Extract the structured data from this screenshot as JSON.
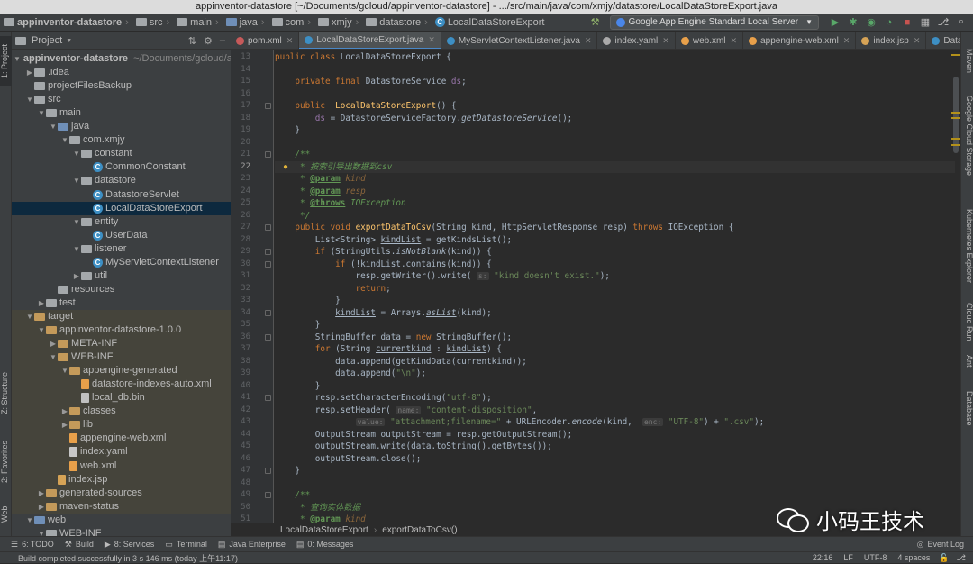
{
  "window": {
    "title": "appinventor-datastore [~/Documents/gcloud/appinventor-datastore] - .../src/main/java/com/xmjy/datastore/LocalDataStoreExport.java"
  },
  "nav": {
    "crumbs": [
      "appinventor-datastore",
      "src",
      "main",
      "java",
      "com",
      "xmjy",
      "datastore",
      "LocalDataStoreExport"
    ],
    "run_config": "Google App Engine Standard Local Server"
  },
  "left_strip": {
    "project": "1: Project",
    "structure": "Z: Structure",
    "favorites": "2: Favorites",
    "web": "Web"
  },
  "right_strip": {
    "maven": "Maven",
    "gcs": "Google Cloud Storage",
    "k8s": "Kubernetes Explorer",
    "cloudrun": "Cloud Run",
    "ant": "Ant",
    "database": "Database"
  },
  "project": {
    "header": "Project",
    "tree": [
      {
        "label": "appinventor-datastore",
        "suffix": "~/Documents/gcloud/app",
        "depth": 0,
        "arrow": "down",
        "icon": "folder",
        "bold": true
      },
      {
        "label": ".idea",
        "depth": 1,
        "arrow": "right",
        "icon": "folder"
      },
      {
        "label": "projectFilesBackup",
        "depth": 1,
        "arrow": "none",
        "icon": "folder"
      },
      {
        "label": "src",
        "depth": 1,
        "arrow": "down",
        "icon": "folder"
      },
      {
        "label": "main",
        "depth": 2,
        "arrow": "down",
        "icon": "folder"
      },
      {
        "label": "java",
        "depth": 3,
        "arrow": "down",
        "icon": "folder-blue"
      },
      {
        "label": "com.xmjy",
        "depth": 4,
        "arrow": "down",
        "icon": "folder"
      },
      {
        "label": "constant",
        "depth": 5,
        "arrow": "down",
        "icon": "folder"
      },
      {
        "label": "CommonConstant",
        "depth": 6,
        "arrow": "none",
        "icon": "class"
      },
      {
        "label": "datastore",
        "depth": 5,
        "arrow": "down",
        "icon": "folder"
      },
      {
        "label": "DatastoreServlet",
        "depth": 6,
        "arrow": "none",
        "icon": "class"
      },
      {
        "label": "LocalDataStoreExport",
        "depth": 6,
        "arrow": "none",
        "icon": "class",
        "selected": true
      },
      {
        "label": "entity",
        "depth": 5,
        "arrow": "down",
        "icon": "folder"
      },
      {
        "label": "UserData",
        "depth": 6,
        "arrow": "none",
        "icon": "class"
      },
      {
        "label": "listener",
        "depth": 5,
        "arrow": "down",
        "icon": "folder"
      },
      {
        "label": "MyServletContextListener",
        "depth": 6,
        "arrow": "none",
        "icon": "class"
      },
      {
        "label": "util",
        "depth": 5,
        "arrow": "right",
        "icon": "folder"
      },
      {
        "label": "resources",
        "depth": 3,
        "arrow": "none",
        "icon": "folder"
      },
      {
        "label": "test",
        "depth": 2,
        "arrow": "right",
        "icon": "folder"
      },
      {
        "label": "target",
        "depth": 1,
        "arrow": "down",
        "icon": "folder-orange",
        "excluded": true
      },
      {
        "label": "appinventor-datastore-1.0.0",
        "depth": 2,
        "arrow": "down",
        "icon": "folder-orange",
        "excluded": true
      },
      {
        "label": "META-INF",
        "depth": 3,
        "arrow": "right",
        "icon": "folder-orange",
        "excluded": true
      },
      {
        "label": "WEB-INF",
        "depth": 3,
        "arrow": "down",
        "icon": "folder-orange",
        "excluded": true
      },
      {
        "label": "appengine-generated",
        "depth": 4,
        "arrow": "down",
        "icon": "folder-orange",
        "excluded": true
      },
      {
        "label": "datastore-indexes-auto.xml",
        "depth": 5,
        "arrow": "none",
        "icon": "xml",
        "excluded": true
      },
      {
        "label": "local_db.bin",
        "depth": 5,
        "arrow": "none",
        "icon": "file",
        "excluded": true
      },
      {
        "label": "classes",
        "depth": 4,
        "arrow": "right",
        "icon": "folder-orange",
        "excluded": true
      },
      {
        "label": "lib",
        "depth": 4,
        "arrow": "right",
        "icon": "folder-orange",
        "excluded": true
      },
      {
        "label": "appengine-web.xml",
        "depth": 4,
        "arrow": "none",
        "icon": "xml",
        "excluded": true
      },
      {
        "label": "index.yaml",
        "depth": 4,
        "arrow": "none",
        "icon": "yml",
        "excluded": true
      },
      {
        "label": "web.xml",
        "depth": 4,
        "arrow": "none",
        "icon": "xml",
        "excluded": true
      },
      {
        "label": "index.jsp",
        "depth": 3,
        "arrow": "none",
        "icon": "jsp",
        "excluded": true
      },
      {
        "label": "generated-sources",
        "depth": 2,
        "arrow": "right",
        "icon": "folder-orange",
        "excluded": true
      },
      {
        "label": "maven-status",
        "depth": 2,
        "arrow": "right",
        "icon": "folder-orange",
        "excluded": true
      },
      {
        "label": "web",
        "depth": 1,
        "arrow": "down",
        "icon": "folder-blue"
      },
      {
        "label": "WEB-INF",
        "depth": 2,
        "arrow": "down",
        "icon": "folder"
      }
    ]
  },
  "tabs": [
    {
      "label": "pom.xml",
      "icon": "m"
    },
    {
      "label": "LocalDataStoreExport.java",
      "icon": "c",
      "active": true
    },
    {
      "label": "MyServletContextListener.java",
      "icon": "c"
    },
    {
      "label": "index.yaml",
      "icon": "y"
    },
    {
      "label": "web.xml",
      "icon": "x"
    },
    {
      "label": "appengine-web.xml",
      "icon": "x"
    },
    {
      "label": "index.jsp",
      "icon": "j"
    },
    {
      "label": "DatastoreS",
      "icon": "c"
    }
  ],
  "editor": {
    "current_line": "22",
    "lines": [
      {
        "n": "13",
        "html": "<span class=\"kw\">public class </span>LocalDataStoreExport {"
      },
      {
        "n": "14",
        "html": ""
      },
      {
        "n": "15",
        "html": "    <span class=\"kw\">private final </span>DatastoreService <span class=\"fld\">ds</span>;"
      },
      {
        "n": "16",
        "html": ""
      },
      {
        "n": "17",
        "html": "    <span class=\"kw\">public  </span><span class=\"fn\">LocalDataStoreExport</span>() {"
      },
      {
        "n": "18",
        "html": "        <span class=\"fld\">ds </span>= DatastoreServiceFactory.<span class=\"it\">getDatastoreService</span>();"
      },
      {
        "n": "19",
        "html": "    }"
      },
      {
        "n": "20",
        "html": ""
      },
      {
        "n": "21",
        "html": "    <span class=\"cmt\">/**</span>"
      },
      {
        "n": "22",
        "html": "<span class=\"cmt\">     * 按索引导出数据到csv</span>",
        "cur": true
      },
      {
        "n": "23",
        "html": "<span class=\"cmt\">     * </span><span class=\"tag\">@param</span><span class=\"tagv\"> kind</span>"
      },
      {
        "n": "24",
        "html": "<span class=\"cmt\">     * </span><span class=\"tag\">@param</span><span class=\"tagv\"> resp</span>"
      },
      {
        "n": "25",
        "html": "<span class=\"cmt\">     * </span><span class=\"tag\">@throws</span><span class=\"cmt\"> IOException</span>"
      },
      {
        "n": "26",
        "html": "<span class=\"cmt\">     */</span>"
      },
      {
        "n": "27",
        "html": "    <span class=\"kw\">public void </span><span class=\"fn\">exportDataToCsv</span>(String kind, HttpServletResponse resp) <span class=\"kw\">throws </span>IOException {"
      },
      {
        "n": "28",
        "html": "        List&lt;String&gt; <span class=\"ul\">kindList</span> = getKindsList();"
      },
      {
        "n": "29",
        "html": "        <span class=\"kw\">if </span>(StringUtils.<span class=\"it\">isNotBlank</span>(kind)) {"
      },
      {
        "n": "30",
        "html": "            <span class=\"kw\">if </span>(!<span class=\"ul\">kindList</span>.contains(kind)) {"
      },
      {
        "n": "31",
        "html": "                resp.getWriter().write( <span class=\"hint\">s:</span> <span class=\"str\">\"kind doesn't exist.\"</span>);"
      },
      {
        "n": "32",
        "html": "                <span class=\"kw\">return</span>;"
      },
      {
        "n": "33",
        "html": "            }"
      },
      {
        "n": "34",
        "html": "            <span class=\"ul\">kindList</span> = Arrays.<span class=\"it ul\">asList</span>(kind);"
      },
      {
        "n": "35",
        "html": "        }"
      },
      {
        "n": "36",
        "html": "        StringBuffer <span class=\"ul\">data</span> = <span class=\"kw\">new </span>StringBuffer();"
      },
      {
        "n": "37",
        "html": "        <span class=\"kw\">for </span>(String <span class=\"ul\">currentkind</span> : <span class=\"ul\">kindList</span>) {"
      },
      {
        "n": "38",
        "html": "            data.append(getKindData(currentkind));"
      },
      {
        "n": "39",
        "html": "            data.append(<span class=\"str\">\"\\n\"</span>);"
      },
      {
        "n": "40",
        "html": "        }"
      },
      {
        "n": "41",
        "html": "        resp.setCharacterEncoding(<span class=\"str\">\"utf-8\"</span>);"
      },
      {
        "n": "42",
        "html": "        resp.setHeader( <span class=\"hint\">name:</span> <span class=\"str\">\"content-disposition\"</span>,"
      },
      {
        "n": "43",
        "html": "                <span class=\"hint\">value:</span> <span class=\"str\">\"attachment;filename=\"</span> + URLEncoder.<span class=\"it\">encode</span>(kind,  <span class=\"hint\">enc:</span> <span class=\"str\">\"UTF-8\"</span>) + <span class=\"str\">\".csv\"</span>);"
      },
      {
        "n": "44",
        "html": "        OutputStream outputStream = resp.getOutputStream();"
      },
      {
        "n": "45",
        "html": "        outputStream.write(data.toString().getBytes());"
      },
      {
        "n": "46",
        "html": "        outputStream.close();"
      },
      {
        "n": "47",
        "html": "    }"
      },
      {
        "n": "48",
        "html": ""
      },
      {
        "n": "49",
        "html": "    <span class=\"cmt\">/**</span>"
      },
      {
        "n": "50",
        "html": "<span class=\"cmt\">     * 查询实体数据</span>"
      },
      {
        "n": "51",
        "html": "<span class=\"cmt\">     * </span><span class=\"tag\">@param</span><span class=\"tagv\"> kind</span>"
      }
    ]
  },
  "breadcrumb_bottom": [
    "LocalDataStoreExport",
    "exportDataToCsv()"
  ],
  "tool_windows": [
    {
      "label": "6: TODO",
      "icon": "☰"
    },
    {
      "label": "Build",
      "icon": "⚒"
    },
    {
      "label": "8: Services",
      "icon": "▶"
    },
    {
      "label": "Terminal",
      "icon": "▭"
    },
    {
      "label": "Java Enterprise",
      "icon": "▤"
    },
    {
      "label": "0: Messages",
      "icon": "▤"
    }
  ],
  "event_log": "Event Log",
  "status": {
    "message": "Build completed successfully in 3 s 146 ms (today 上午11:17)",
    "position": "22:16",
    "line_sep": "LF",
    "encoding": "UTF-8",
    "indent": "4 spaces"
  },
  "watermark": "小码王技术"
}
